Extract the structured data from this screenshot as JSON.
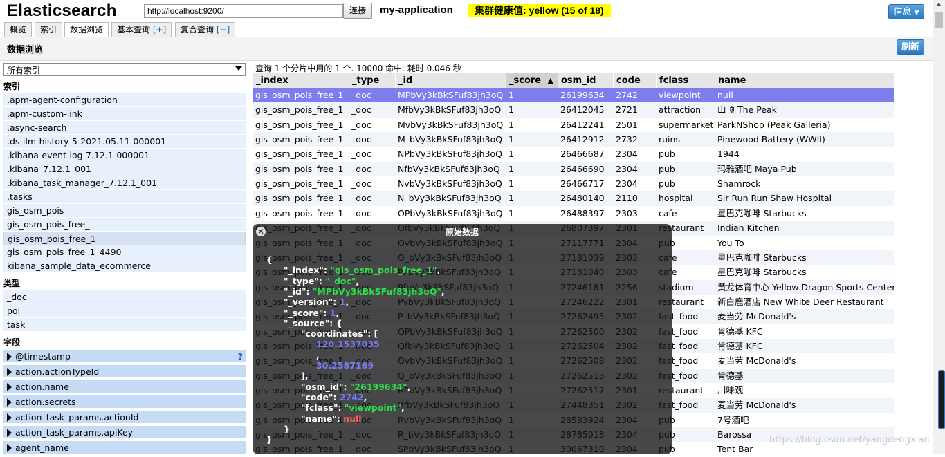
{
  "header": {
    "title": "Elasticsearch",
    "url": "http://localhost:9200/",
    "connect_label": "连接",
    "cluster_name": "my-application",
    "health": "集群健康值: yellow (15 of 18)",
    "info_label": "信息"
  },
  "tabs": [
    {
      "label": "概览",
      "plus": ""
    },
    {
      "label": "索引",
      "plus": ""
    },
    {
      "label": "数据浏览",
      "plus": ""
    },
    {
      "label": "基本查询 ",
      "plus": "[+]"
    },
    {
      "label": "复合查询 ",
      "plus": "[+]"
    }
  ],
  "page_title": "数据浏览",
  "refresh_label": "刷新",
  "sidebar": {
    "index_select": "所有索引",
    "indices_heading": "索引",
    "indices": [
      ".apm-agent-configuration",
      ".apm-custom-link",
      ".async-search",
      ".ds-ilm-history-5-2021.05.11-000001",
      ".kibana-event-log-7.12.1-000001",
      ".kibana_7.12.1_001",
      ".kibana_task_manager_7.12.1_001",
      ".tasks",
      "gis_osm_pois",
      "gis_osm_pois_free_",
      "gis_osm_pois_free_1",
      "gis_osm_pois_free_1_4490",
      "kibana_sample_data_ecommerce"
    ],
    "selected_index": "gis_osm_pois_free_1",
    "types_heading": "类型",
    "types": [
      "_doc",
      "poi",
      "task"
    ],
    "fields_heading": "字段",
    "fields": [
      "@timestamp",
      "action.actionTypeId",
      "action.name",
      "action.secrets",
      "action_task_params.actionId",
      "action_task_params.apiKey",
      "agent_name"
    ],
    "help_mark": "?"
  },
  "results": {
    "summary": "查询 1 个分片中用的 1 个. 10000 命中. 耗时 0.046 秒",
    "columns": [
      "_index",
      "_type",
      "_id",
      "_score",
      "osm_id",
      "code",
      "fclass",
      "name"
    ],
    "sort_indicator": "▲",
    "rows": [
      [
        "gis_osm_pois_free_1",
        "_doc",
        "MPbVy3kBkSFuf83jh3oQ",
        "1",
        "26199634",
        "2742",
        "viewpoint",
        "null"
      ],
      [
        "gis_osm_pois_free_1",
        "_doc",
        "MfbVy3kBkSFuf83jh3oQ",
        "1",
        "26412045",
        "2721",
        "attraction",
        "山顶 The Peak"
      ],
      [
        "gis_osm_pois_free_1",
        "_doc",
        "MvbVy3kBkSFuf83jh3oQ",
        "1",
        "26412241",
        "2501",
        "supermarket",
        "ParkNShop (Peak Galleria)"
      ],
      [
        "gis_osm_pois_free_1",
        "_doc",
        "M_bVy3kBkSFuf83jh3oQ",
        "1",
        "26412912",
        "2732",
        "ruins",
        "Pinewood Battery (WWII)"
      ],
      [
        "gis_osm_pois_free_1",
        "_doc",
        "NPbVy3kBkSFuf83jh3oQ",
        "1",
        "26466687",
        "2304",
        "pub",
        "1944"
      ],
      [
        "gis_osm_pois_free_1",
        "_doc",
        "NfbVy3kBkSFuf83jh3oQ",
        "1",
        "26466690",
        "2304",
        "pub",
        "玛雅酒吧 Maya Pub"
      ],
      [
        "gis_osm_pois_free_1",
        "_doc",
        "NvbVy3kBkSFuf83jh3oQ",
        "1",
        "26466717",
        "2304",
        "pub",
        "Shamrock"
      ],
      [
        "gis_osm_pois_free_1",
        "_doc",
        "N_bVy3kBkSFuf83jh3oQ",
        "1",
        "26480140",
        "2110",
        "hospital",
        "Sir Run Run Shaw Hospital"
      ],
      [
        "gis_osm_pois_free_1",
        "_doc",
        "OPbVy3kBkSFuf83jh3oQ",
        "1",
        "26488397",
        "2303",
        "cafe",
        "星巴克咖啡 Starbucks"
      ],
      [
        "gis_osm_pois_free_1",
        "_doc",
        "OfbVy3kBkSFuf83jh3oQ",
        "1",
        "26807397",
        "2301",
        "restaurant",
        "Indian Kitchen"
      ],
      [
        "gis_osm_pois_free_1",
        "_doc",
        "OvbVy3kBkSFuf83jh3oQ",
        "1",
        "27117771",
        "2304",
        "pub",
        "You To"
      ],
      [
        "gis_osm_pois_free_1",
        "_doc",
        "O_bVy3kBkSFuf83jh3oQ",
        "1",
        "27181039",
        "2303",
        "cafe",
        "星巴克咖啡 Starbucks"
      ],
      [
        "gis_osm_pois_free_1",
        "_doc",
        "PPbVy3kBkSFuf83jh3oQ",
        "1",
        "27181040",
        "2303",
        "cafe",
        "星巴克咖啡 Starbucks"
      ],
      [
        "gis_osm_pois_free_1",
        "_doc",
        "PfbVy3kBkSFuf83jh3oQ",
        "1",
        "27246181",
        "2256",
        "stadium",
        "黄龙体育中心 Yellow Dragon Sports Center"
      ],
      [
        "gis_osm_pois_free_1",
        "_doc",
        "PvbVy3kBkSFuf83jh3oQ",
        "1",
        "27246222",
        "2301",
        "restaurant",
        "新白鹿酒店 New White Deer Restaurant"
      ],
      [
        "gis_osm_pois_free_1",
        "_doc",
        "P_bVy3kBkSFuf83jh3oQ",
        "1",
        "27262495",
        "2302",
        "fast_food",
        "麦当劳 McDonald's"
      ],
      [
        "gis_osm_pois_free_1",
        "_doc",
        "QPbVy3kBkSFuf83jh3oQ",
        "1",
        "27262500",
        "2302",
        "fast_food",
        "肯德基 KFC"
      ],
      [
        "gis_osm_pois_free_1",
        "_doc",
        "QfbVy3kBkSFuf83jh3oQ",
        "1",
        "27262504",
        "2302",
        "fast_food",
        "肯德基 KFC"
      ],
      [
        "gis_osm_pois_free_1",
        "_doc",
        "QvbVy3kBkSFuf83jh3oQ",
        "1",
        "27262508",
        "2302",
        "fast_food",
        "麦当劳 McDonald's"
      ],
      [
        "gis_osm_pois_free_1",
        "_doc",
        "Q_bVy3kBkSFuf83jh3oQ",
        "1",
        "27262513",
        "2302",
        "fast_food",
        "肯德基"
      ],
      [
        "gis_osm_pois_free_1",
        "_doc",
        "RPbVy3kBkSFuf83jh3oQ",
        "1",
        "27262517",
        "2301",
        "restaurant",
        "川味观"
      ],
      [
        "gis_osm_pois_free_1",
        "_doc",
        "RfbVy3kBkSFuf83jh3oQ",
        "1",
        "27448351",
        "2302",
        "fast_food",
        "麦当劳 McDonald's"
      ],
      [
        "gis_osm_pois_free_1",
        "_doc",
        "RvbVy3kBkSFuf83jh3oQ",
        "1",
        "28583924",
        "2304",
        "pub",
        "7号酒吧"
      ],
      [
        "gis_osm_pois_free_1",
        "_doc",
        "R_bVy3kBkSFuf83jh3oQ",
        "1",
        "28785018",
        "2304",
        "pub",
        "Barossa"
      ],
      [
        "gis_osm_pois_free_1",
        "_doc",
        "SPbVy3kBkSFuf83jh3oQ",
        "1",
        "30067310",
        "2304",
        "pub",
        "Tent Bar"
      ]
    ]
  },
  "popup": {
    "title": "原始数据",
    "close_icon": "close-icon",
    "lines": [
      {
        "indent": 0,
        "parts": [
          {
            "t": "k",
            "v": "{"
          }
        ]
      },
      {
        "indent": 1,
        "parts": [
          {
            "t": "k",
            "v": "\"_index\": "
          },
          {
            "t": "s",
            "v": "\"gis_osm_pois_free_1\""
          },
          {
            "t": "k",
            "v": ","
          }
        ]
      },
      {
        "indent": 1,
        "parts": [
          {
            "t": "k",
            "v": "\"_type\": "
          },
          {
            "t": "s",
            "v": "\"_doc\""
          },
          {
            "t": "k",
            "v": ","
          }
        ]
      },
      {
        "indent": 1,
        "parts": [
          {
            "t": "k",
            "v": "\"_id\": "
          },
          {
            "t": "s",
            "v": "\"MPbVy3kBkSFuf83jh3oQ\""
          },
          {
            "t": "k",
            "v": ","
          }
        ]
      },
      {
        "indent": 1,
        "parts": [
          {
            "t": "k",
            "v": "\"_version\": "
          },
          {
            "t": "n",
            "v": "1"
          },
          {
            "t": "k",
            "v": ","
          }
        ]
      },
      {
        "indent": 1,
        "parts": [
          {
            "t": "k",
            "v": "\"_score\": "
          },
          {
            "t": "n",
            "v": "1"
          },
          {
            "t": "k",
            "v": ","
          }
        ]
      },
      {
        "indent": 1,
        "parts": [
          {
            "t": "k",
            "v": "\"_source\": {"
          }
        ]
      },
      {
        "indent": 2,
        "parts": [
          {
            "t": "k",
            "v": "\"coordinates\": ["
          }
        ]
      },
      {
        "indent": 3,
        "parts": [
          {
            "t": "n",
            "v": "120.1537035"
          }
        ]
      },
      {
        "indent": 3,
        "parts": [
          {
            "t": "k",
            "v": ","
          }
        ]
      },
      {
        "indent": 3,
        "parts": [
          {
            "t": "n",
            "v": "30.2587169"
          }
        ]
      },
      {
        "indent": 2,
        "parts": [
          {
            "t": "k",
            "v": "],"
          }
        ]
      },
      {
        "indent": 2,
        "parts": [
          {
            "t": "k",
            "v": "\"osm_id\": "
          },
          {
            "t": "s",
            "v": "\"26199634\""
          },
          {
            "t": "k",
            "v": ","
          }
        ]
      },
      {
        "indent": 2,
        "parts": [
          {
            "t": "k",
            "v": "\"code\": "
          },
          {
            "t": "n",
            "v": "2742"
          },
          {
            "t": "k",
            "v": ","
          }
        ]
      },
      {
        "indent": 2,
        "parts": [
          {
            "t": "k",
            "v": "\"fclass\": "
          },
          {
            "t": "s",
            "v": "\"viewpoint\""
          },
          {
            "t": "k",
            "v": ","
          }
        ]
      },
      {
        "indent": 2,
        "parts": [
          {
            "t": "k",
            "v": "\"name\": "
          },
          {
            "t": "null",
            "v": "null"
          }
        ]
      },
      {
        "indent": 1,
        "parts": [
          {
            "t": "k",
            "v": "}"
          }
        ]
      },
      {
        "indent": 0,
        "parts": [
          {
            "t": "k",
            "v": "}"
          }
        ]
      }
    ]
  },
  "watermark": "https://blog.csdn.net/yangdengxian",
  "colors": {
    "accent_button": "#2a78c2",
    "health_bg": "#ffff00",
    "selected_row": "#7d7ded",
    "json_string": "#2dde4a",
    "json_number": "#7b7bff",
    "json_null": "#ff5b5b"
  }
}
